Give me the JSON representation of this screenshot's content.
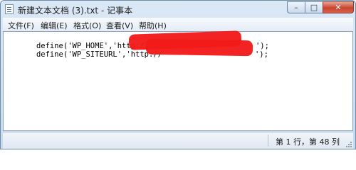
{
  "window": {
    "title": "新建文本文档 (3).txt - 记事本",
    "controls": {
      "minimize": "–",
      "maximize": "□",
      "close": "✕"
    }
  },
  "menu": {
    "items": [
      {
        "label": "文件(F)"
      },
      {
        "label": "编辑(E)"
      },
      {
        "label": "格式(O)"
      },
      {
        "label": "查看(V)"
      },
      {
        "label": "帮助(H)"
      }
    ]
  },
  "editor": {
    "lines": [
      {
        "visible": "define('WP_HOME','http://",
        "tail": "');"
      },
      {
        "visible": "define('WP_SITEURL','http://",
        "tail": "');"
      }
    ],
    "redaction_color": "#f21a1a"
  },
  "status": {
    "position": "第 1 行，第 48 列"
  },
  "icons": {
    "app": "notepad-icon",
    "grip": "resize-grip-icon"
  }
}
